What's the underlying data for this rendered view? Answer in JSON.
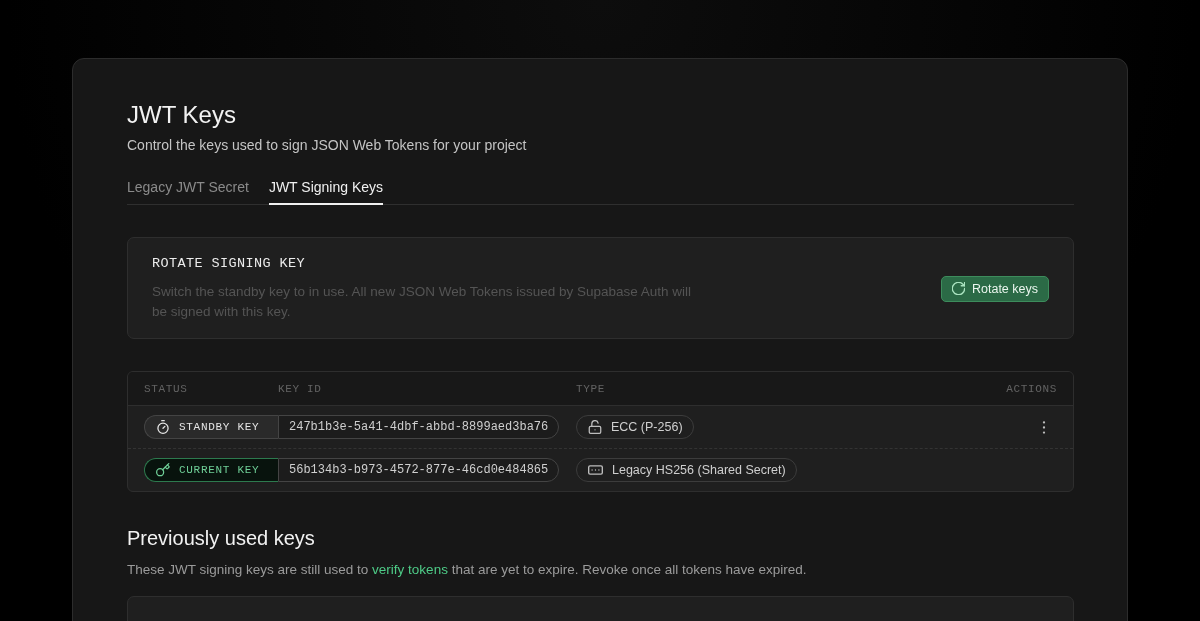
{
  "header": {
    "title": "JWT Keys",
    "subtitle": "Control the keys used to sign JSON Web Tokens for your project"
  },
  "tabs": [
    {
      "label": "Legacy JWT Secret",
      "selected": false
    },
    {
      "label": "JWT Signing Keys",
      "selected": true
    }
  ],
  "rotate_card": {
    "title": "ROTATE SIGNING KEY",
    "description": "Switch the standby key to in use. All new JSON Web Tokens issued by Supabase Auth will be signed with this key.",
    "button": "Rotate keys"
  },
  "keys_table": {
    "columns": [
      "STATUS",
      "KEY ID",
      "TYPE",
      "ACTIONS"
    ],
    "rows": [
      {
        "kind": "standby",
        "status": "STANDBY KEY",
        "key_id": "247b1b3e-5a41-4dbf-abbd-8899aed3ba76",
        "type": {
          "kind": "ecc",
          "label": "ECC (P-256)"
        },
        "actions_menu": true
      },
      {
        "kind": "current",
        "status": "CURRENT KEY",
        "key_id": "56b134b3-b973-4572-877e-46cd0e484865",
        "type": {
          "kind": "shared_secret",
          "label": "Legacy HS256 (Shared Secret)"
        },
        "actions_menu": false
      }
    ]
  },
  "previous": {
    "title": "Previously used keys",
    "description_before": "These JWT signing keys are still used to",
    "link": "verify tokens",
    "description_after": "that are yet to expire. Revoke once all tokens have expired."
  }
}
